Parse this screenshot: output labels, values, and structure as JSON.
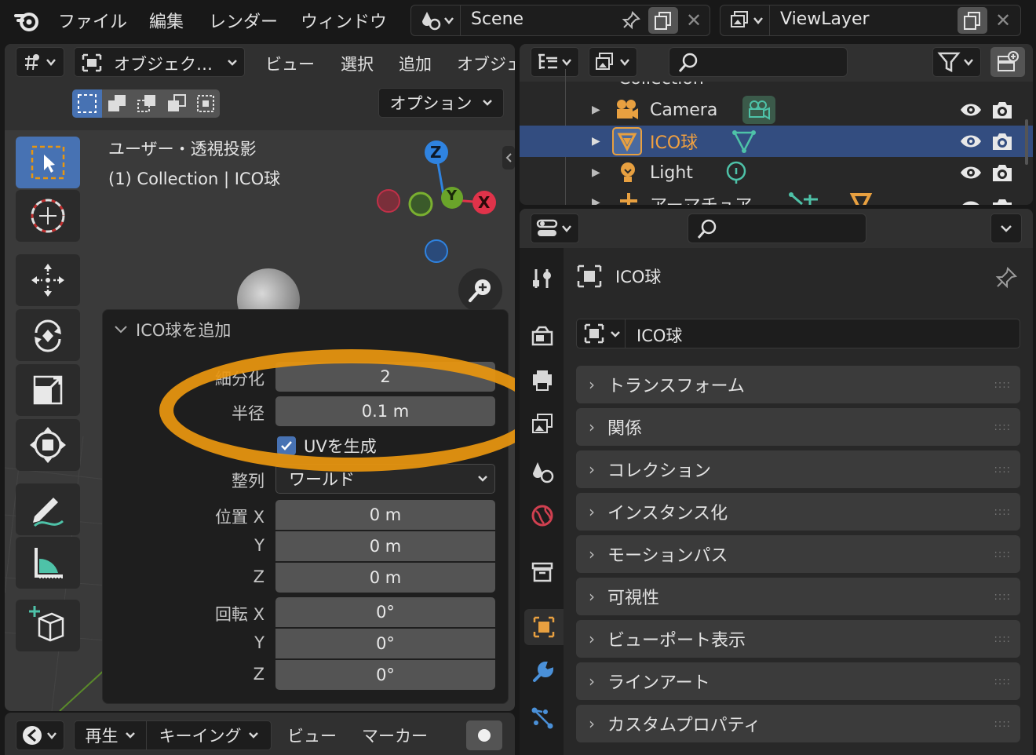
{
  "topbar": {
    "menu": [
      "ファイル",
      "編集",
      "レンダー",
      "ウィンドウ"
    ],
    "scene_name": "Scene",
    "view_layer_name": "ViewLayer"
  },
  "viewport_header": {
    "mode_label": "オブジェク…",
    "menus": [
      "ビュー",
      "選択",
      "追加",
      "オブジェ"
    ],
    "options_label": "オプション"
  },
  "viewport": {
    "view_title": "ユーザー・透視投影",
    "view_subtitle": "(1) Collection | ICO球",
    "gizmo": {
      "z": "Z",
      "y": "Y",
      "x": "X"
    }
  },
  "operator_panel": {
    "title": "ICO球を追加",
    "subdivisions": {
      "label": "細分化",
      "value": "2"
    },
    "radius": {
      "label": "半径",
      "value": "0.1 m"
    },
    "generate_uv": {
      "label": "UVを生成",
      "checked": true
    },
    "align": {
      "label": "整列",
      "value": "ワールド"
    },
    "location": {
      "label": "位置 X",
      "y_label": "Y",
      "z_label": "Z",
      "x": "0 m",
      "y": "0 m",
      "z": "0 m"
    },
    "rotation": {
      "label": "回転 X",
      "y_label": "Y",
      "z_label": "Z",
      "x": "0°",
      "y": "0°",
      "z": "0°"
    }
  },
  "highlight_color": "#e8960f",
  "outliner": {
    "top_partial": "Collection",
    "rows": [
      {
        "name": "Camera",
        "selected": false
      },
      {
        "name": "ICO球",
        "selected": true
      },
      {
        "name": "Light",
        "selected": false
      },
      {
        "name": "アーマチュア",
        "selected": false
      }
    ]
  },
  "properties": {
    "object_name": "ICO球",
    "datablock_name": "ICO球",
    "sections": [
      "トランスフォーム",
      "関係",
      "コレクション",
      "インスタンス化",
      "モーションパス",
      "可視性",
      "ビューポート表示",
      "ラインアート",
      "カスタムプロパティ"
    ]
  },
  "timeline": {
    "menus": [
      "再生",
      "キーイング",
      "ビュー",
      "マーカー"
    ]
  }
}
